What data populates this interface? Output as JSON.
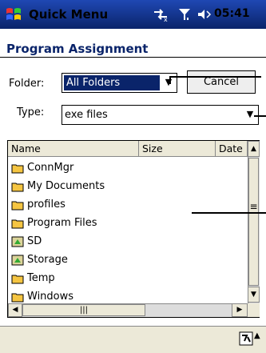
{
  "titlebar": {
    "app": "Quick Menu",
    "time": "05:41"
  },
  "header": {
    "title": "Program Assignment"
  },
  "form": {
    "folder_label": "Folder:",
    "folder_value": "All Folders",
    "cancel_label": "Cancel",
    "type_label": "Type:",
    "type_value": "exe files"
  },
  "list": {
    "columns": [
      "Name",
      "Size",
      "Date"
    ],
    "items": [
      {
        "name": "ConnMgr",
        "icon": "folder-icon"
      },
      {
        "name": "My Documents",
        "icon": "folder-icon"
      },
      {
        "name": "profiles",
        "icon": "folder-icon"
      },
      {
        "name": "Program Files",
        "icon": "folder-icon"
      },
      {
        "name": "SD",
        "icon": "storage-card-icon"
      },
      {
        "name": "Storage",
        "icon": "storage-card-icon"
      },
      {
        "name": "Temp",
        "icon": "folder-icon"
      },
      {
        "name": "Windows",
        "icon": "folder-icon"
      }
    ]
  },
  "colors": {
    "title_bg": "#0a246a",
    "title_text": "#0a246a",
    "selection": "#0a246a",
    "folder": "#f5c542"
  }
}
